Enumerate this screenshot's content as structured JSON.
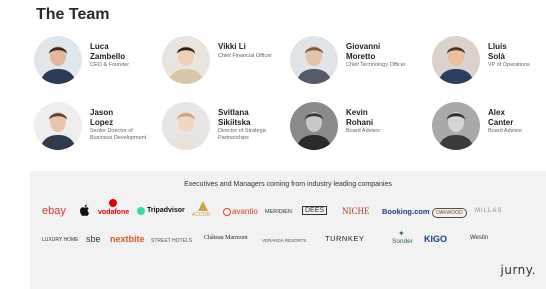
{
  "title": "The Team",
  "team": [
    {
      "name_l1": "Luca",
      "name_l2": "Zambello",
      "role": "CEO & Founder",
      "bg": "#dfe6ec",
      "skin": "#e3b89a",
      "hair": "#3a2a20",
      "shirt": "#2b3a55"
    },
    {
      "name_l1": "Vikki Li",
      "name_l2": "",
      "role": "Chief Financial Officer",
      "bg": "#e9e4de",
      "skin": "#f0cfb7",
      "hair": "#2a1f1a",
      "shirt": "#d9c6a6"
    },
    {
      "name_l1": "Giovanni",
      "name_l2": "Moretto",
      "role": "Chief Technology Officer",
      "bg": "#dfe4e8",
      "skin": "#e6c2a6",
      "hair": "#7a5a40",
      "shirt": "#555c66"
    },
    {
      "name_l1": "Lluís",
      "name_l2": "Solà",
      "role": "VP of Operations",
      "bg": "#d9d3cb",
      "skin": "#e8c0a0",
      "hair": "#4a3526",
      "shirt": "#2c3e60"
    },
    {
      "name_l1": "Jason",
      "name_l2": "Lopez",
      "role": "Senior Director of Business Development",
      "bg": "#eeeeee",
      "skin": "#e8c4a8",
      "hair": "#5a4030",
      "shirt": "#2f3a4a"
    },
    {
      "name_l1": "Svitlana",
      "name_l2": "Sikiitska",
      "role": "Director of Strategic Partnerships",
      "bg": "#e6e6e6",
      "skin": "#f3d6c2",
      "hair": "#c9a47a",
      "shirt": "#e8e2da"
    },
    {
      "name_l1": "Kevin",
      "name_l2": "Rohani",
      "role": "Board Advisor",
      "bg": "#8a8a8a",
      "skin": "#c9c9c9",
      "hair": "#3a3a3a",
      "shirt": "#2a2a2a"
    },
    {
      "name_l1": "Alex",
      "name_l2": "Canter",
      "role": "Board Advisor",
      "bg": "#a9a9a9",
      "skin": "#d5d5d5",
      "hair": "#2e2e2e",
      "shirt": "#3a3a3a"
    }
  ],
  "companies_title": "Executives and Managers coming from industry leading companies",
  "logos_row1": [
    {
      "text": "ebay",
      "color": "#e53238"
    },
    {
      "text": "",
      "color": "#111111"
    },
    {
      "text": "vodafone",
      "color": "#e60000"
    },
    {
      "text": "Tripadvisor",
      "color": "#111111"
    },
    {
      "text": "ACCOR",
      "color": "#c9a24a"
    },
    {
      "text": "avantio",
      "color": "#e0401c"
    },
    {
      "text": "MERIDIEN",
      "color": "#333333"
    },
    {
      "text": "DEES",
      "color": "#333333"
    },
    {
      "text": "NICHE",
      "color": "#c0392b"
    },
    {
      "text": "Booking.com",
      "color": "#1e3a8a"
    },
    {
      "text": "OAKWOOD",
      "color": "#5a4a3a"
    },
    {
      "text": "MILLAS",
      "color": "#888888"
    }
  ],
  "logos_row2": [
    {
      "text": "LUXURY HOME",
      "color": "#333333"
    },
    {
      "text": "sbe",
      "color": "#333333"
    },
    {
      "text": "nextbite",
      "color": "#e2572a"
    },
    {
      "text": "STREET HOTELS",
      "color": "#555555"
    },
    {
      "text": "Château Marmont",
      "color": "#222222"
    },
    {
      "text": "VERANDA RESORTS",
      "color": "#555555"
    },
    {
      "text": "TURNKEY",
      "color": "#222222"
    },
    {
      "text": "Sonder",
      "color": "#2d6a4f"
    },
    {
      "text": "KIGO",
      "color": "#1a3e8c"
    },
    {
      "text": "Westin",
      "color": "#333333"
    }
  ],
  "brand": "jurny."
}
